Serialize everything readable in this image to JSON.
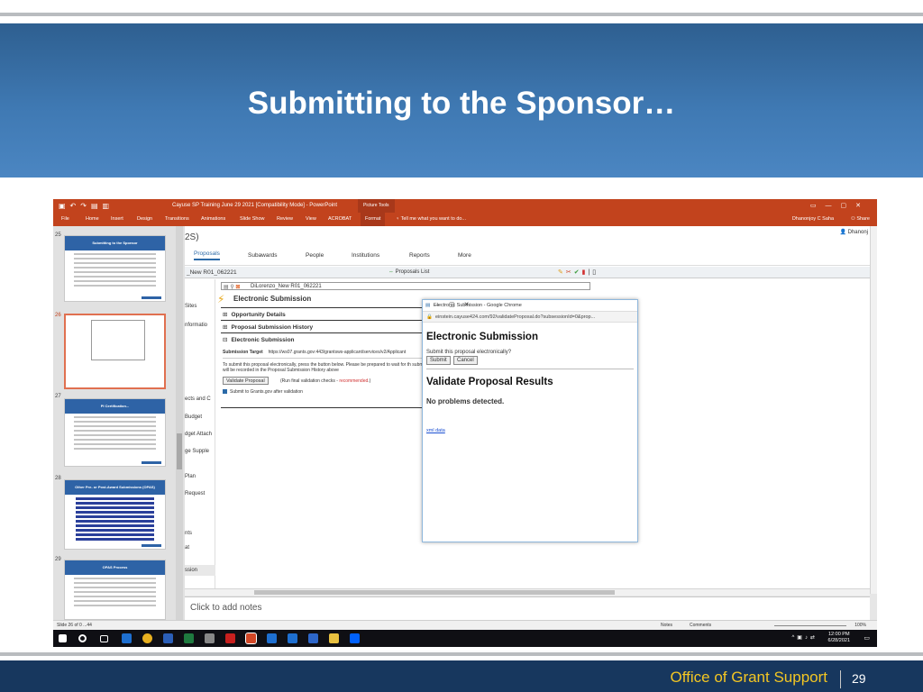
{
  "slide": {
    "title": "Submitting to the Sponsor…",
    "footer_text": "Office of Grant Support",
    "page_number": "29"
  },
  "powerpoint": {
    "window_title": "Cayuse SP Training June 29 2021 [Compatibility Mode] - PowerPoint",
    "context_tab": "Picture Tools",
    "ribbon_tabs": [
      "File",
      "Home",
      "Insert",
      "Design",
      "Transitions",
      "Animations",
      "Slide Show",
      "Review",
      "View",
      "ACROBAT",
      "Format"
    ],
    "selected_ribbon_tab": "Format",
    "tell_me": "Tell me what you want to do...",
    "user_name": "Dhanonjoy C Saha",
    "share_label": "Share",
    "thumb_numbers": [
      "25",
      "26",
      "27",
      "28",
      "29"
    ],
    "thumb_titles": [
      "Submitting to the Sponsor",
      "",
      "PI Certification...",
      "Other Pre- or Post-Award Submissions (OPAS)",
      "OPAS Process"
    ],
    "notes_placeholder": "Click to add notes",
    "status_slide": "Slide 26 of 0 ...44",
    "status_notes": "Notes",
    "status_comments": "Comments",
    "zoom": "100%",
    "clock_time": "12:00 PM",
    "clock_date": "6/28/2021"
  },
  "cayuse": {
    "title_fragment": "2S)",
    "user": "Dhanonj",
    "nav": [
      "Proposals",
      "Subawards",
      "People",
      "Institutions",
      "Reports",
      "More"
    ],
    "active_nav": "Proposals",
    "proposal_label": "_New R01_062221",
    "proposals_list": "Proposals List",
    "path_value": "DiLorenzo_New R01_062221",
    "side_menu": [
      "Sites",
      "nformatio",
      "ects and C",
      "Budget",
      "dget Attach",
      "ge Supple",
      "Plan",
      "Request",
      "nts",
      "at",
      "ssion"
    ],
    "section_title": "Electronic Submission",
    "accordions": [
      "Opportunity Details",
      "Proposal Submission History",
      "Electronic Submission"
    ],
    "accordion_markers": [
      "⊞",
      "⊞",
      "⊟"
    ],
    "submission_target_label": "Submission Target",
    "submission_target_url": "https://ws07.grants.gov:443/grantsws-applicant/services/v2/Applicant",
    "submit_instructions": "To submit this proposal electronically, press the button below. Please be prepared to wait for th submission will be recorded in the Proposal Submission History above",
    "validate_button": "Validate Proposal",
    "validate_note": "(Run final validation checks - ",
    "validate_recommended": "recommended",
    "validate_note_end": ".)",
    "checkbox_label": "Submit to Grants.gov after validation"
  },
  "popup": {
    "window_title": "Electronic Submission - Google Chrome",
    "url": "einstein.cayuse424.com/92/validateProposal.do?subsessionId=0&prop...",
    "heading": "Electronic Submission",
    "question": "Submit this proposal electronically?",
    "submit_button": "Submit",
    "cancel_button": "Cancel",
    "results_heading": "Validate Proposal Results",
    "results_text": "No problems detected.",
    "xml_link": "xml data"
  }
}
